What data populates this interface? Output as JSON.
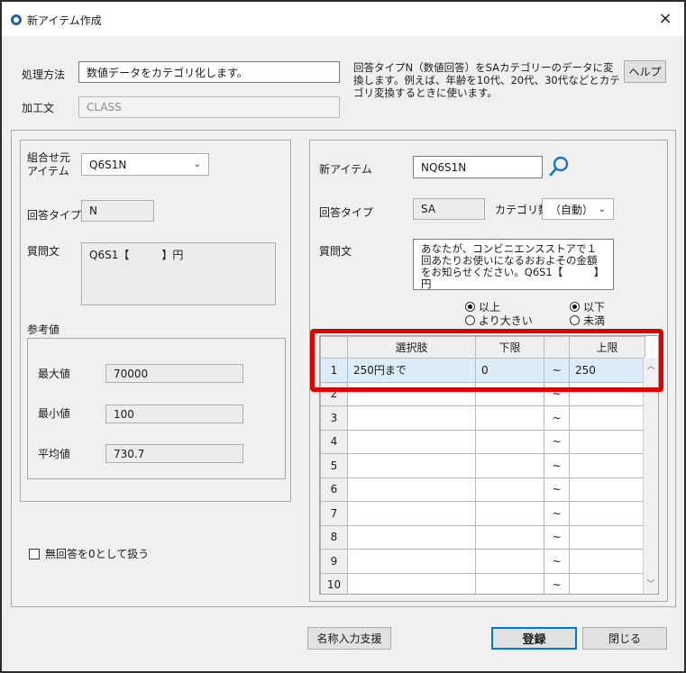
{
  "window": {
    "title": "新アイテム作成",
    "close_glyph": "×"
  },
  "top": {
    "method_label": "処理方法",
    "method_value": "数値データをカテゴリ化します。",
    "process_label": "加工文",
    "process_value": "CLASS",
    "description": "回答タイプN（数値回答）をSAカテゴリーのデータに変換します。例えば、年齢を10代、20代、30代などとカテゴリ変換するときに使います。",
    "help_label": "ヘルプ"
  },
  "left": {
    "source_label": "組合せ元アイテム",
    "source_value": "Q6S1N",
    "answer_type_label": "回答タイプ",
    "answer_type_value": "N",
    "question_label": "質問文",
    "question_value": "Q6S1【　　　】円",
    "reference_label": "参考値",
    "max_label": "最大値",
    "max_value": "70000",
    "min_label": "最小値",
    "min_value": "100",
    "avg_label": "平均値",
    "avg_value": "730.7",
    "no_answer_label": "無回答を0として扱う"
  },
  "right": {
    "new_item_label": "新アイテム",
    "new_item_value": "NQ6S1N",
    "answer_type_label": "回答タイプ",
    "answer_type_value": "SA",
    "category_count_label": "カテゴリ数",
    "category_count_value": "（自動）",
    "question_label": "質問文",
    "question_value": "あなたが、コンビニエンスストアで１回あたりお使いになるおおよその金額をお知らせください。Q6S1【　　　】円",
    "radio_lower_on": "以上",
    "radio_lower_off": "より大きい",
    "radio_upper_on": "以下",
    "radio_upper_off": "未満"
  },
  "grid": {
    "headers": [
      "選択肢",
      "下限",
      "上限"
    ],
    "rows": [
      {
        "no": "1",
        "choice": "250円まで",
        "lower": "0",
        "tilde": "~",
        "upper": "250"
      },
      {
        "no": "2",
        "choice": "",
        "lower": "",
        "tilde": "~",
        "upper": ""
      },
      {
        "no": "3",
        "choice": "",
        "lower": "",
        "tilde": "~",
        "upper": ""
      },
      {
        "no": "4",
        "choice": "",
        "lower": "",
        "tilde": "~",
        "upper": ""
      },
      {
        "no": "5",
        "choice": "",
        "lower": "",
        "tilde": "~",
        "upper": ""
      },
      {
        "no": "6",
        "choice": "",
        "lower": "",
        "tilde": "~",
        "upper": ""
      },
      {
        "no": "7",
        "choice": "",
        "lower": "",
        "tilde": "~",
        "upper": ""
      },
      {
        "no": "8",
        "choice": "",
        "lower": "",
        "tilde": "~",
        "upper": ""
      },
      {
        "no": "9",
        "choice": "",
        "lower": "",
        "tilde": "~",
        "upper": ""
      },
      {
        "no": "10",
        "choice": "",
        "lower": "",
        "tilde": "~",
        "upper": ""
      }
    ]
  },
  "footer": {
    "name_assist_label": "名称入力支援",
    "register_label": "登録",
    "close_label": "閉じる"
  },
  "colors": {
    "highlight": "#e00000",
    "search_icon": "#1a73c9",
    "selected_row": "#dcecf8"
  }
}
